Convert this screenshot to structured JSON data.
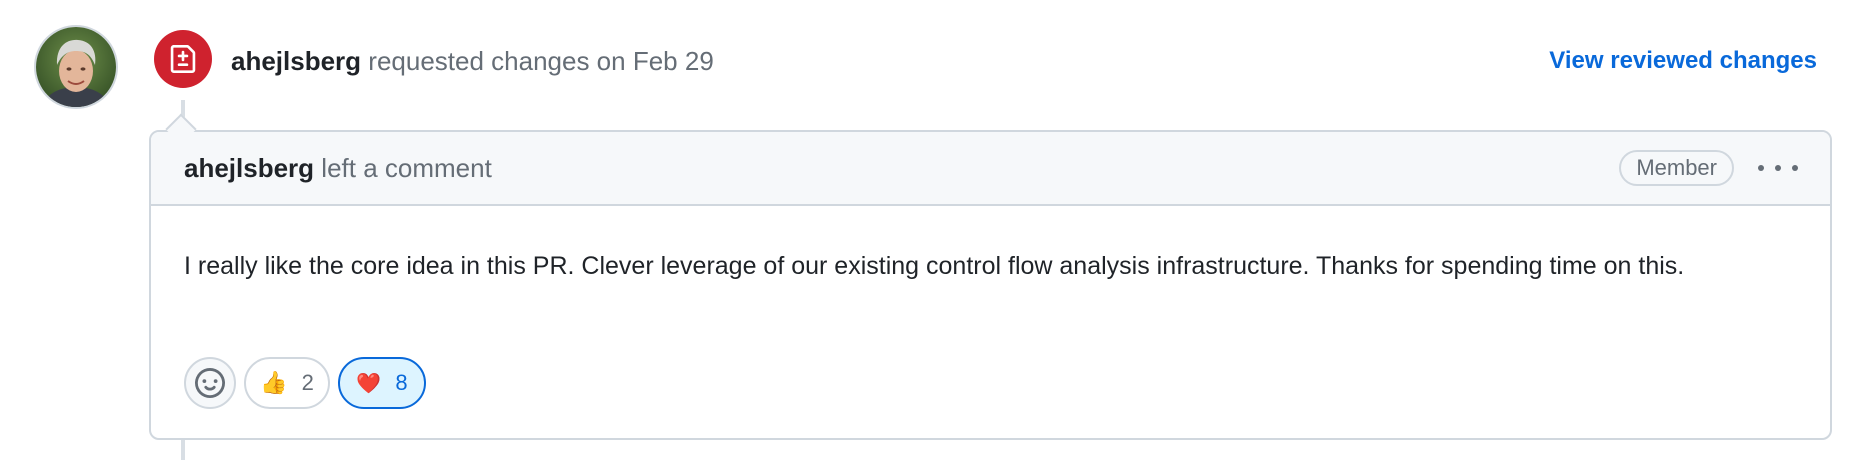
{
  "review": {
    "author": "ahejlsberg",
    "action": "requested changes on Feb 29",
    "view_link": "View reviewed changes",
    "status_icon": "file-diff-icon",
    "status_color": "#cf222e"
  },
  "comment": {
    "author": "ahejlsberg",
    "action": "left a comment",
    "role_badge": "Member",
    "menu_icon": "kebab-horizontal-icon",
    "body": "I really like the core idea in this PR. Clever leverage of our existing control flow analysis infrastructure. Thanks for spending time on this."
  },
  "reactions": [
    {
      "icon": "thumbs-up-icon",
      "emoji": "👍",
      "count": "2",
      "selected": false
    },
    {
      "icon": "heart-icon",
      "emoji": "❤️",
      "count": "8",
      "selected": true
    }
  ],
  "colors": {
    "link": "#0969da",
    "muted": "#656d76",
    "border": "#d0d7de",
    "header_bg": "#f6f8fa",
    "selected_reaction_bg": "#ddf4ff"
  }
}
